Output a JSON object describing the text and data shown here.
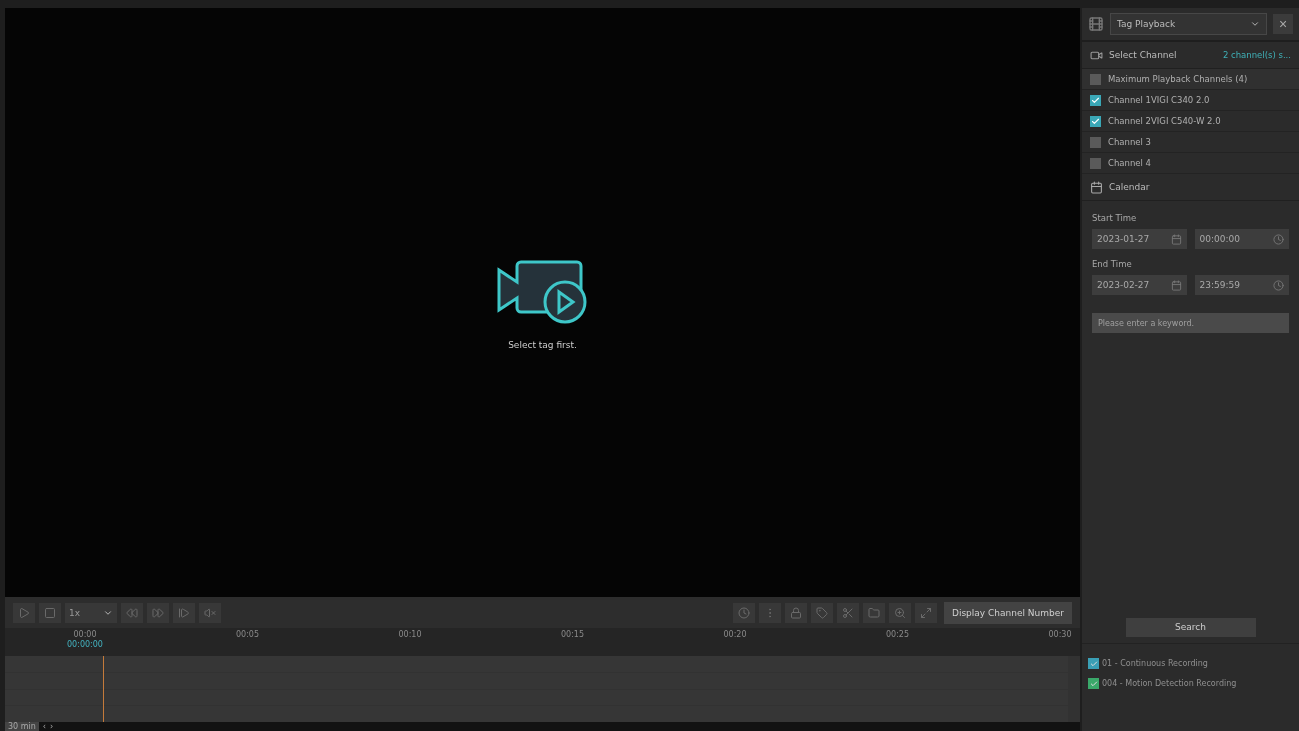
{
  "player": {
    "message": "Select tag first."
  },
  "controls": {
    "speed": "1x",
    "display_button": "Display Channel Number"
  },
  "timeline": {
    "ticks": [
      "00:00",
      "00:05",
      "00:10",
      "00:15",
      "00:20",
      "00:25",
      "00:30"
    ],
    "current_time": "00:00:00",
    "zoom": "30 min",
    "prev": "‹",
    "next": "›"
  },
  "panel": {
    "mode": "Tag Playback",
    "close": "×",
    "select_channel": {
      "label": "Select Channel",
      "summary": "2 channel(s) s..."
    },
    "channels": [
      {
        "label": "Maximum Playback Channels (4)",
        "checked": false
      },
      {
        "label": "Channel 1VIGI C340 2.0",
        "checked": true
      },
      {
        "label": "Channel 2VIGI C540-W 2.0",
        "checked": true
      },
      {
        "label": "Channel 3",
        "checked": false
      },
      {
        "label": "Channel 4",
        "checked": false
      }
    ],
    "calendar": "Calendar",
    "start": {
      "label": "Start Time",
      "date": "2023-01-27",
      "time": "00:00:00"
    },
    "end": {
      "label": "End Time",
      "date": "2023-02-27",
      "time": "23:59:59"
    },
    "keyword": {
      "placeholder": "Please enter a keyword."
    },
    "search": "Search",
    "legend": [
      {
        "label": "01 - Continuous Recording",
        "color": "#3a9fb5",
        "checked": true
      },
      {
        "label": "004 - Motion Detection Recording",
        "color": "#3aa86a",
        "checked": true
      }
    ]
  }
}
